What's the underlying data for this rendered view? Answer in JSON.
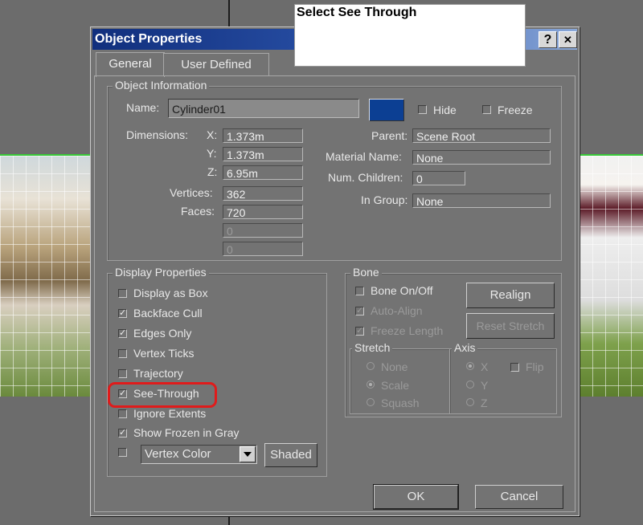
{
  "callout": {
    "text": "Select See Through"
  },
  "dialog": {
    "title": "Object Properties",
    "help_button": "?",
    "close_button": "✕",
    "tabs": [
      {
        "label": "General",
        "active": true
      },
      {
        "label": "User Defined",
        "active": false
      }
    ],
    "object_info": {
      "group_label": "Object Information",
      "name_label": "Name:",
      "name_value": "Cylinder01",
      "color": "#0c3f93",
      "hide_label": "Hide",
      "freeze_label": "Freeze",
      "dimensions_label": "Dimensions:",
      "x_label": "X:",
      "x_value": "1.373m",
      "y_label": "Y:",
      "y_value": "1.373m",
      "z_label": "Z:",
      "z_value": "6.95m",
      "vertices_label": "Vertices:",
      "vertices_value": "362",
      "faces_label": "Faces:",
      "faces_value": "720",
      "extra1_value": "0",
      "extra2_value": "0",
      "parent_label": "Parent:",
      "parent_value": "Scene Root",
      "material_label": "Material Name:",
      "material_value": "None",
      "children_label": "Num. Children:",
      "children_value": "0",
      "group_in_label": "In Group:",
      "group_in_value": "None"
    },
    "display": {
      "group_label": "Display Properties",
      "items": [
        {
          "label": "Display as Box",
          "checked": false
        },
        {
          "label": "Backface Cull",
          "checked": true
        },
        {
          "label": "Edges Only",
          "checked": true
        },
        {
          "label": "Vertex Ticks",
          "checked": false
        },
        {
          "label": "Trajectory",
          "checked": false
        },
        {
          "label": "See-Through",
          "checked": true
        },
        {
          "label": "Ignore Extents",
          "checked": false
        },
        {
          "label": "Show Frozen in Gray",
          "checked": true
        }
      ],
      "vertex_color_label": "Vertex Color",
      "shaded_button": "Shaded"
    },
    "bone": {
      "group_label": "Bone",
      "bone_on_off": "Bone On/Off",
      "auto_align": "Auto-Align",
      "freeze_length": "Freeze Length",
      "realign_button": "Realign",
      "reset_stretch_button": "Reset Stretch",
      "stretch_label": "Stretch",
      "stretch_options": [
        "None",
        "Scale",
        "Squash"
      ],
      "axis_label": "Axis",
      "axis_options": [
        "X",
        "Y",
        "Z"
      ],
      "flip_label": "Flip"
    },
    "ok_button": "OK",
    "cancel_button": "Cancel"
  }
}
